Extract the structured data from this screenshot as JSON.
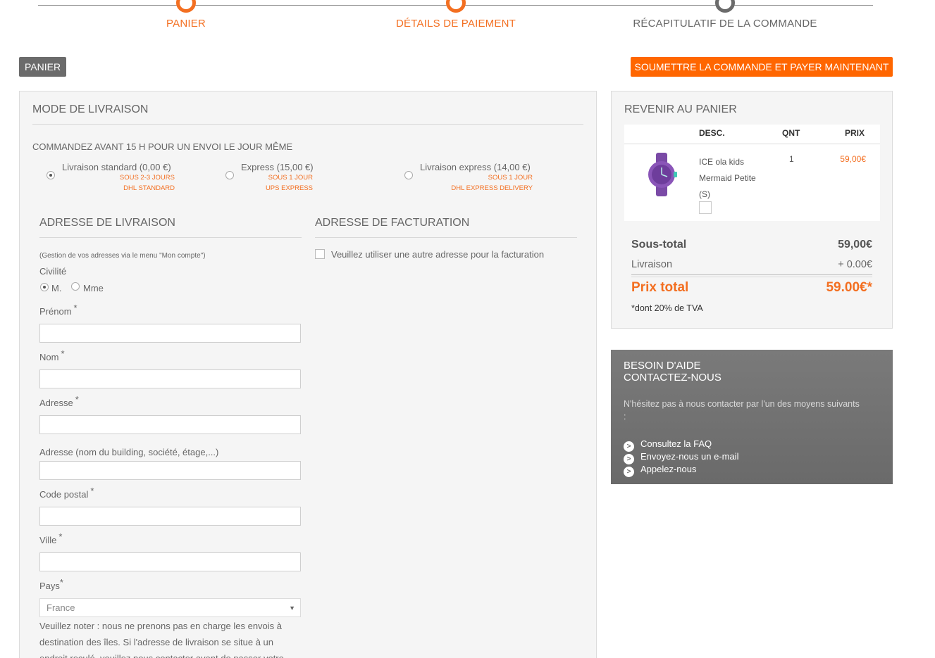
{
  "steps": [
    {
      "label": "PANIER",
      "state": "done"
    },
    {
      "label": "DÉTAILS DE PAIEMENT",
      "state": "current"
    },
    {
      "label": "RÉCAPITULATIF DE LA COMMANDE",
      "state": "todo"
    }
  ],
  "colors": {
    "accent": "#f36f21",
    "button_orange": "#ff6600",
    "grey": "#6b6b6b"
  },
  "top": {
    "back_label": "PANIER",
    "submit_label": "SOUMETTRE LA COMMANDE ET PAYER MAINTENANT >"
  },
  "shipping": {
    "title": "MODE DE LIVRAISON",
    "sameday": "COMMANDEZ AVANT 15 H POUR UN ENVOI LE JOUR MÊME",
    "options": [
      {
        "name": "Livraison standard (0,00 €)",
        "delay": "SOUS 2-3 JOURS",
        "carrier": "DHL STANDARD",
        "selected": true
      },
      {
        "name": "Express (15,00 €)",
        "delay": "SOUS 1 JOUR",
        "carrier": "UPS EXPRESS",
        "selected": false
      },
      {
        "name": "Livraison express (14,00 €)",
        "delay": "SOUS 1 JOUR",
        "carrier": "DHL EXPRESS DELIVERY",
        "selected": false
      }
    ]
  },
  "delivery_address": {
    "title": "ADRESSE DE LIVRAISON",
    "note": "(Gestion de vos adresses via le menu \"Mon compte\")",
    "civility_label": "Civilité",
    "civility_options": [
      "M.",
      "Mme"
    ],
    "civility_selected": "M.",
    "fields": {
      "first_name": "Prénom",
      "last_name": "Nom",
      "address": "Adresse",
      "address2": "Adresse (nom du building, société, étage,...)",
      "postcode": "Code postal",
      "city": "Ville",
      "country": "Pays"
    },
    "required_mark": "*",
    "country_value": "France",
    "islands_note": "Veuillez noter : nous ne prenons pas en charge les envois à destination des îles. Si l'adresse de livraison se situe à un endroit reculé, veuillez nous contacter avant de passer votre"
  },
  "billing_address": {
    "title": "ADRESSE DE FACTURATION",
    "checkbox_label": "Veuillez utiliser une autre adresse pour la facturation"
  },
  "cart": {
    "title": "REVENIR AU PANIER",
    "headers": {
      "desc": "DESC.",
      "qty": "QNT",
      "price": "PRIX"
    },
    "item": {
      "name": "ICE ola kids Mermaid Petite (S)",
      "qty": "1",
      "price": "59,00€",
      "icon": "purple-watch-image"
    },
    "subtotal_label": "Sous-total",
    "subtotal_value": "59,00€",
    "shipping_label": "Livraison",
    "shipping_value": "+ 0.00€",
    "total_label": "Prix total",
    "total_value": "59.00€*",
    "vat_note": "*dont 20% de TVA"
  },
  "help": {
    "title_line1": "BESOIN D'AIDE",
    "title_line2": "CONTACTEZ-NOUS",
    "text": "N'hésitez pas à nous contacter par l'un des moyens suivants :",
    "arrow": ">",
    "links": [
      "Consultez la FAQ",
      "Envoyez-nous un e-mail",
      "Appelez-nous"
    ]
  }
}
